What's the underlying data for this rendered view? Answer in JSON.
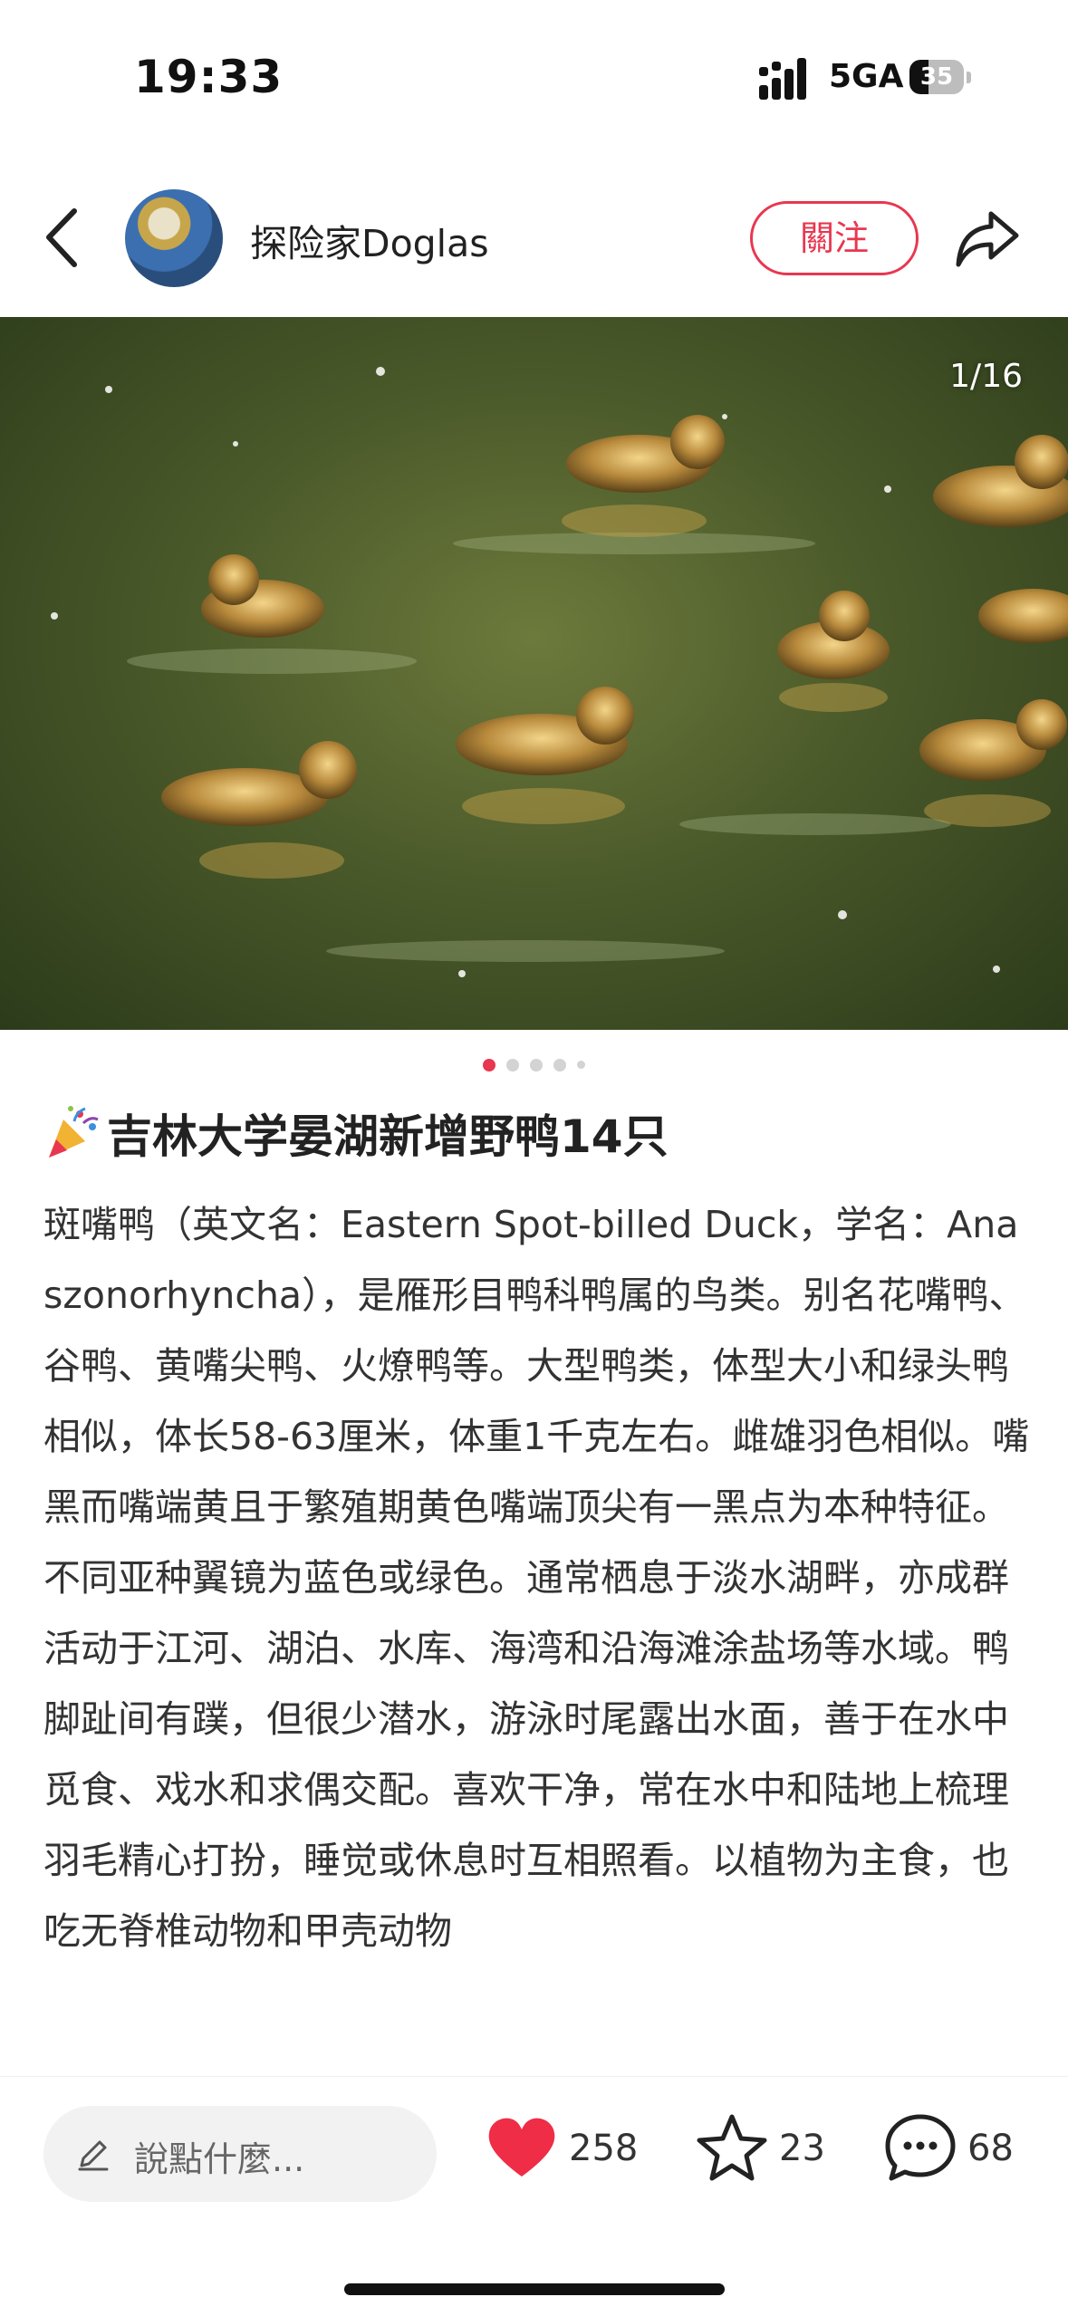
{
  "status": {
    "time": "19:33",
    "network": "5GA",
    "battery": "35",
    "battery_level": 0.35
  },
  "header": {
    "author_name": "探险家Doglas",
    "follow_label": "關注"
  },
  "gallery": {
    "counter": "1/16",
    "current_index": 1,
    "total": 16
  },
  "post": {
    "title": "吉林大学晏湖新增野鸭14只",
    "body": "斑嘴鸭（英文名：Eastern Spot-billed Duck，学名：Anaszonorhyncha），是雁形目鸭科鸭属的鸟类。别名花嘴鸭、谷鸭、黄嘴尖鸭、火燎鸭等。大型鸭类，体型大小和绿头鸭相似，体长58-63厘米，体重1千克左右。雌雄羽色相似。嘴黑而嘴端黄且于繁殖期黄色嘴端顶尖有一黑点为本种特征。不同亚种翼镜为蓝色或绿色。通常栖息于淡水湖畔，亦成群活动于江河、湖泊、水库、海湾和沿海滩涂盐场等水域。鸭脚趾间有蹼，但很少潜水，游泳时尾露出水面，善于在水中觅食、戏水和求偶交配。喜欢干净，常在水中和陆地上梳理羽毛精心打扮，睡觉或休息时互相照看。以植物为主食，也吃无脊椎动物和甲壳动物"
  },
  "bottom_bar": {
    "comment_placeholder": "說點什麼...",
    "likes": "258",
    "favorites": "23",
    "comments": "68"
  },
  "colors": {
    "accent": "#e8374f",
    "like": "#ef2d46"
  },
  "icons": [
    "back-icon",
    "share-icon",
    "pen-icon",
    "heart-icon",
    "star-icon",
    "comment-icon",
    "party-popper-icon"
  ]
}
